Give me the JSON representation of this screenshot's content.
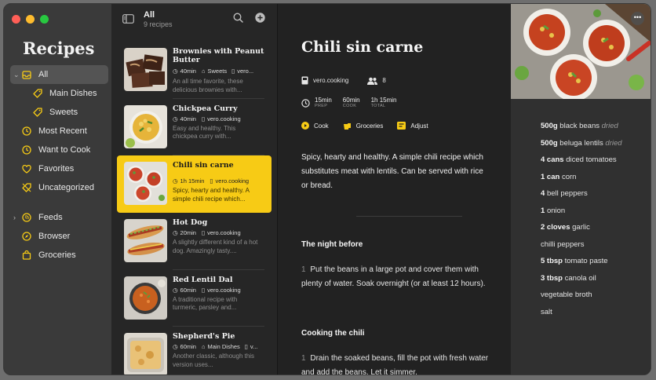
{
  "app": {
    "title": "Recipes"
  },
  "colors": {
    "accent": "#f7cb15",
    "sidebar": "#3a3a3a",
    "list": "#262626",
    "detail": "#222222",
    "ingredients": "#303030"
  },
  "sidebar": {
    "items": [
      {
        "label": "All",
        "icon": "tray-icon",
        "active": true
      },
      {
        "label": "Main Dishes",
        "icon": "tag-icon"
      },
      {
        "label": "Sweets",
        "icon": "tag-icon"
      },
      {
        "label": "Most Recent",
        "icon": "clock-icon"
      },
      {
        "label": "Want to Cook",
        "icon": "clock-icon"
      },
      {
        "label": "Favorites",
        "icon": "heart-icon"
      },
      {
        "label": "Uncategorized",
        "icon": "untag-icon"
      },
      {
        "label": "Feeds",
        "icon": "feeds-icon"
      },
      {
        "label": "Browser",
        "icon": "compass-icon"
      },
      {
        "label": "Groceries",
        "icon": "bag-icon"
      }
    ]
  },
  "list": {
    "title": "All",
    "count": "9 recipes",
    "recipes": [
      {
        "title": "Brownies with Peanut Butter",
        "time": "40min",
        "source": "Sweets",
        "source2": "vero...",
        "desc": "An all time favorite, these delicious brownies with..."
      },
      {
        "title": "Chickpea Curry",
        "time": "40min",
        "source": "vero.cooking",
        "desc": "Easy and healthy. This chickpea curry with..."
      },
      {
        "title": "Chili sin carne",
        "time": "1h 15min",
        "source": "vero.cooking",
        "desc": "Spicy, hearty and healthy. A simple chili recipe which..."
      },
      {
        "title": "Hot Dog",
        "time": "20min",
        "source": "vero.cooking",
        "desc": "A slightly different kind of a hot dog. Amazingly tasty...."
      },
      {
        "title": "Red Lentil Dal",
        "time": "60min",
        "source": "vero.cooking",
        "desc": "A traditional recipe with turmeric, parsley and..."
      },
      {
        "title": "Shepherd's Pie",
        "time": "60min",
        "source": "Main Dishes",
        "source2": "v...",
        "desc": "Another classic, although this version uses..."
      }
    ]
  },
  "detail": {
    "title": "Chili sin carne",
    "source": "vero.cooking",
    "servings": "8",
    "prep": "15min",
    "prep_label": "PREP",
    "cook": "60min",
    "cook_label": "COOK",
    "total": "1h 15min",
    "total_label": "TOTAL",
    "action_cook": "Cook",
    "action_groceries": "Groceries",
    "action_adjust": "Adjust",
    "intro": "Spicy, hearty and healthy. A simple chili recipe which substitutes meat with lentils. Can be served with rice or bread.",
    "section1": "The night before",
    "step1_n": "1",
    "step1": "Put the beans in a large pot and cover them with plenty of water. Soak overnight (or at least 12 hours).",
    "section2": "Cooking the chili",
    "step2_n": "1",
    "step2": "Drain the soaked beans, fill the pot with fresh water and add the beans. Let it simmer."
  },
  "ingredients": [
    {
      "qty": "500g",
      "name": "black beans",
      "note": "dried"
    },
    {
      "qty": "500g",
      "name": "beluga lentils",
      "note": "dried"
    },
    {
      "qty": "4 cans",
      "name": "diced tomatoes",
      "note": ""
    },
    {
      "qty": "1 can",
      "name": "corn",
      "note": ""
    },
    {
      "qty": "4",
      "name": "bell peppers",
      "note": ""
    },
    {
      "qty": "1",
      "name": "onion",
      "note": ""
    },
    {
      "qty": "2 cloves",
      "name": "garlic",
      "note": ""
    },
    {
      "qty": "",
      "name": "chilli peppers",
      "note": ""
    },
    {
      "qty": "5 tbsp",
      "name": "tomato paste",
      "note": ""
    },
    {
      "qty": "3 tbsp",
      "name": "canola oil",
      "note": ""
    },
    {
      "qty": "",
      "name": "vegetable broth",
      "note": ""
    },
    {
      "qty": "",
      "name": "salt",
      "note": ""
    }
  ]
}
